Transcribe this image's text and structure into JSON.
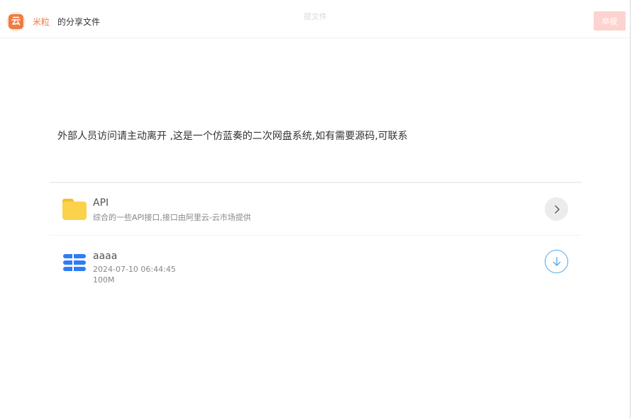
{
  "header": {
    "logo_glyph": "云",
    "user_name": "米粒",
    "share_title": "的分享文件",
    "center_text": "提文件",
    "report_label": "举报"
  },
  "notice": "外部人员访问请主动离开 ,这是一个仿蓝奏的二次网盘系统,如有需要源码,可联系",
  "files": [
    {
      "type": "folder",
      "icon": "folder-icon",
      "name": "API",
      "description": "综合的一些API接口,接口由阿里云-云市场提供",
      "action_icon": "chevron-right-icon"
    },
    {
      "type": "file",
      "icon": "database-icon",
      "name": "aaaa",
      "date": "2024-07-10 06:44:45",
      "size": "100M",
      "action_icon": "download-icon"
    }
  ],
  "colors": {
    "accent": "#ef7b45",
    "report_button": "#fcd3cf",
    "folder": "#fcd14c",
    "file_icon": "#2f7cf6",
    "download": "#4aa8f0"
  }
}
